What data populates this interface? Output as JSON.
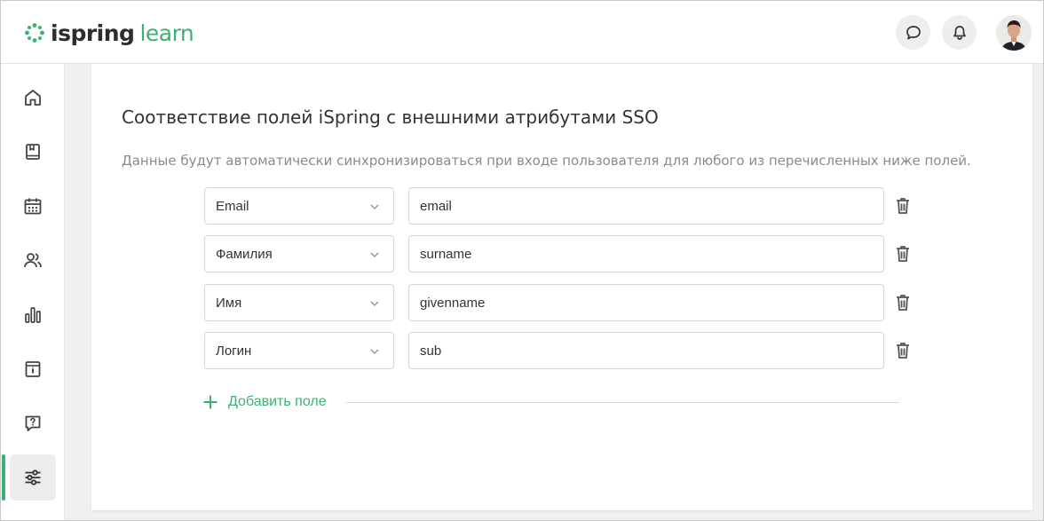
{
  "app": {
    "logo_part1": "ispring",
    "logo_part2": "learn",
    "accent_color": "#3bb273"
  },
  "header": {
    "icons": [
      "chat-icon",
      "bell-icon",
      "avatar"
    ]
  },
  "sidebar": {
    "items": [
      {
        "icon": "home-icon",
        "active": false
      },
      {
        "icon": "book-icon",
        "active": false
      },
      {
        "icon": "calendar-icon",
        "active": false
      },
      {
        "icon": "users-icon",
        "active": false
      },
      {
        "icon": "chart-icon",
        "active": false
      },
      {
        "icon": "info-card-icon",
        "active": false
      },
      {
        "icon": "help-icon",
        "active": false
      },
      {
        "icon": "settings-sliders-icon",
        "active": true
      }
    ]
  },
  "main": {
    "title": "Соответствие полей iSpring с внешними атрибутами SSO",
    "description": "Данные будут автоматически синхронизироваться при входе пользователя для любого из перечисленных ниже полей.",
    "mappings": [
      {
        "field": "Email",
        "attribute": "email"
      },
      {
        "field": "Фамилия",
        "attribute": "surname"
      },
      {
        "field": "Имя",
        "attribute": "givenname"
      },
      {
        "field": "Логин",
        "attribute": "sub"
      }
    ],
    "add_label": "Добавить поле"
  }
}
